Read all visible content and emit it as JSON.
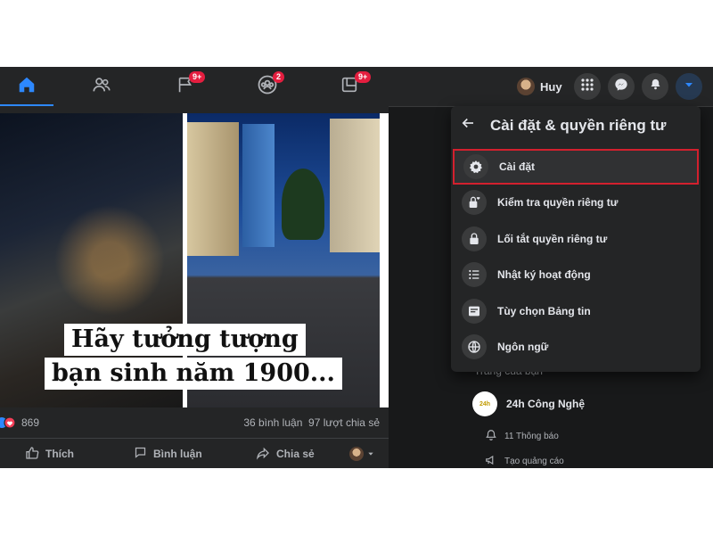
{
  "nav": {
    "tabs": [
      {
        "name": "home",
        "badge": ""
      },
      {
        "name": "friends",
        "badge": ""
      },
      {
        "name": "pages",
        "badge": "9+"
      },
      {
        "name": "groups",
        "badge": "2"
      },
      {
        "name": "gaming",
        "badge": "9+"
      }
    ],
    "profile_name": "Huy",
    "icons": [
      "menu-grid-icon",
      "messenger-icon",
      "bell-icon",
      "caret-down-icon"
    ]
  },
  "post": {
    "caption_line1": "Hãy tưởng tượng",
    "caption_line2": "bạn sinh năm 1900...",
    "reaction_count": "869",
    "comments": "36 bình luận",
    "shares": "97 lượt chia sẻ",
    "actions": {
      "like": "Thích",
      "comment": "Bình luận",
      "share": "Chia sẻ"
    }
  },
  "dropdown": {
    "title": "Cài đặt & quyền riêng tư",
    "items": [
      {
        "label": "Cài đặt",
        "icon": "gear-icon"
      },
      {
        "label": "Kiểm tra quyền riêng tư",
        "icon": "lock-heart-icon"
      },
      {
        "label": "Lối tắt quyền riêng tư",
        "icon": "lock-icon"
      },
      {
        "label": "Nhật ký hoạt động",
        "icon": "list-icon"
      },
      {
        "label": "Tùy chọn Bảng tin",
        "icon": "feed-icon"
      },
      {
        "label": "Ngôn ngữ",
        "icon": "globe-icon"
      }
    ]
  },
  "pages_panel": {
    "heading": "Trang của bạn",
    "page_name": "24h Công Nghệ",
    "logo_text": "24h",
    "notifications": "11 Thông báo",
    "create_ad": "Tạo quảng cáo"
  },
  "colors": {
    "accent": "#2d88ff",
    "badge": "#e41e3f",
    "highlight_border": "#d3202e"
  }
}
